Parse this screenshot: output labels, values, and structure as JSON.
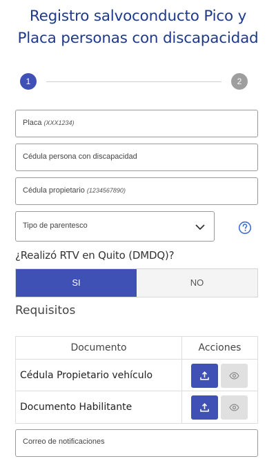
{
  "header": {
    "title_line1": "Registro salvoconducto Pico y",
    "title_line2": "Placa personas con discapacidad"
  },
  "stepper": {
    "step1": "1",
    "step2": "2",
    "current": 1
  },
  "form": {
    "placa_label": "Placa",
    "placa_hint": "(XXX1234)",
    "cedula_discapacidad_label": "Cédula persona con discapacidad",
    "cedula_propietario_label": "Cédula propietario",
    "cedula_propietario_hint": "(1234567890)",
    "parentesco_label": "Tipo de parentesco",
    "rtv_question": "¿Realizó RTV en Quito (DMDQ)?",
    "rtv_yes": "SI",
    "rtv_no": "NO",
    "rtv_selected": "SI",
    "email_label": "Correo de notificaciones"
  },
  "requisitos": {
    "title": "Requisitos",
    "col_documento": "Documento",
    "col_acciones": "Acciones",
    "rows": [
      {
        "documento": "Cédula Propietario vehículo"
      },
      {
        "documento": "Documento Habilitante"
      }
    ]
  },
  "colors": {
    "primary": "#3f51b5",
    "title": "#1f3a8a",
    "inactive_step": "#9e9e9e",
    "disabled_button": "#e0e0e0"
  },
  "icons": {
    "upload": "upload-icon",
    "view": "eye-icon",
    "help": "help-circle-icon",
    "dropdown": "chevron-down-icon"
  }
}
